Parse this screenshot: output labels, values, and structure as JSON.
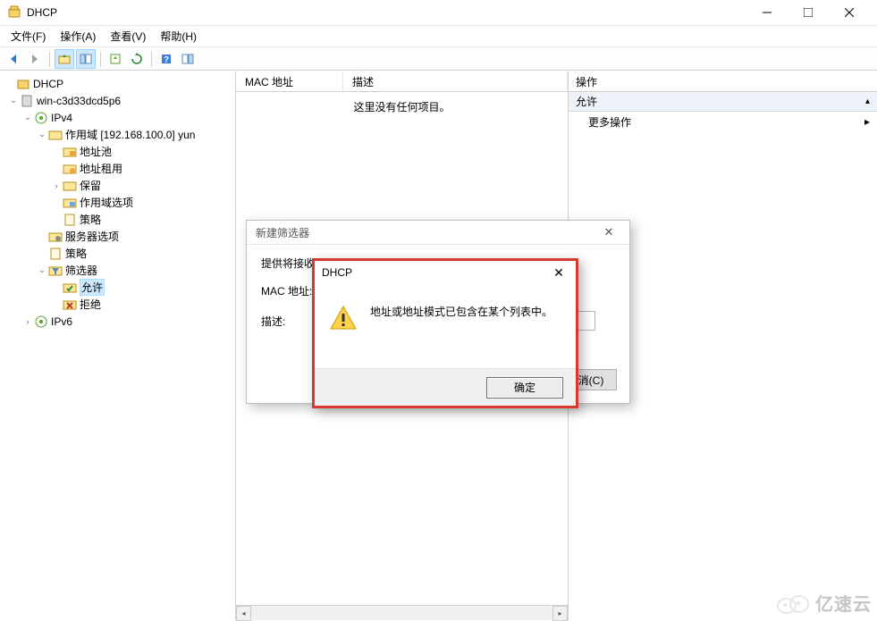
{
  "window": {
    "title": "DHCP"
  },
  "menus": {
    "file": "文件(F)",
    "action": "操作(A)",
    "view": "查看(V)",
    "help": "帮助(H)"
  },
  "tree": {
    "root": "DHCP",
    "server": "win-c3d33dcd5p6",
    "ipv4": "IPv4",
    "scope": "作用域 [192.168.100.0] yun",
    "addr_pool": "地址池",
    "leases": "地址租用",
    "reservations": "保留",
    "scope_options": "作用域选项",
    "policies": "策略",
    "server_options": "服务器选项",
    "server_policies": "策略",
    "filters": "筛选器",
    "allow": "允许",
    "deny": "拒绝",
    "ipv6": "IPv6"
  },
  "list": {
    "col_mac": "MAC 地址",
    "col_desc": "描述",
    "empty": "这里没有任何项目。"
  },
  "actions": {
    "header": "操作",
    "allow": "允许",
    "more": "更多操作"
  },
  "filter_dialog": {
    "title": "新建筛选器",
    "desc_line": "提供将接收",
    "mac_label": "MAC 地址:",
    "desc_label": "描述:",
    "cancel": "取消(C)"
  },
  "msgbox": {
    "title": "DHCP",
    "message": "地址或地址模式已包含在某个列表中。",
    "ok": "确定"
  },
  "watermark": "亿速云"
}
